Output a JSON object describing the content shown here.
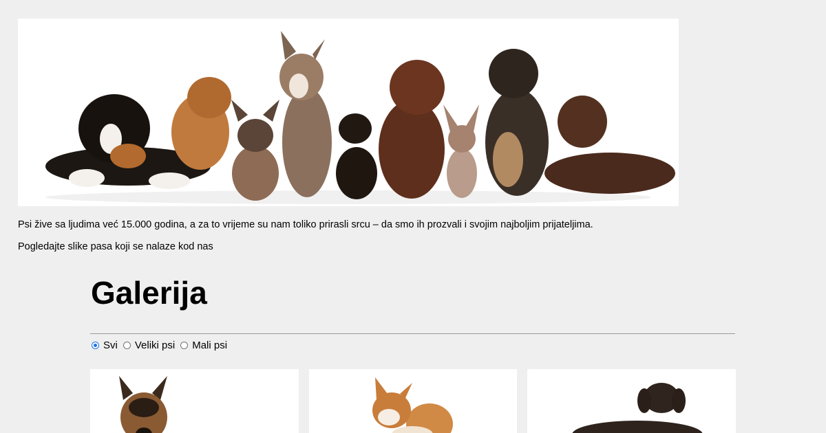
{
  "intro": {
    "paragraph1": "Psi žive sa ljudima već 15.000 godina, a za to vrijeme su nam toliko prirasli srcu – da smo ih prozvali i svojim najboljim prijateljima.",
    "paragraph2": "Pogledajte slike pasa koji se nalaze kod nas"
  },
  "gallery": {
    "title": "Galerija",
    "filters": [
      {
        "label": "Svi",
        "checked": true
      },
      {
        "label": "Veliki psi",
        "checked": false
      },
      {
        "label": "Mali psi",
        "checked": false
      }
    ]
  },
  "images": {
    "hero": "group-of-dogs-banner",
    "cards": [
      "german-shepherd-photo",
      "shiba-inu-photo",
      "chocolate-labrador-photo"
    ]
  },
  "colors": {
    "page_background": "#efefef",
    "accent": "#1a73e8"
  }
}
